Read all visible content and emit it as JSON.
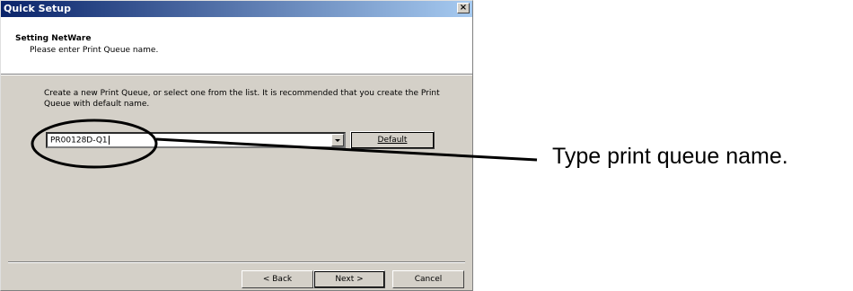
{
  "window": {
    "title": "Quick Setup",
    "close_glyph": "×"
  },
  "header": {
    "title": "Setting NetWare",
    "subtitle": "Please enter Print Queue name."
  },
  "body": {
    "instruction": "Create a new Print Queue, or select one from the list. It is recommended that you create the Print Queue with default name."
  },
  "queue_combo": {
    "value": "PR00128D-Q1"
  },
  "buttons": {
    "default": "Default",
    "back": "< Back",
    "next": "Next >",
    "cancel": "Cancel"
  },
  "annotation": {
    "callout": "Type print queue name."
  },
  "colors": {
    "titlebar_start": "#0a246a",
    "titlebar_end": "#a6caf0",
    "dialog_face": "#d4d0c8"
  }
}
